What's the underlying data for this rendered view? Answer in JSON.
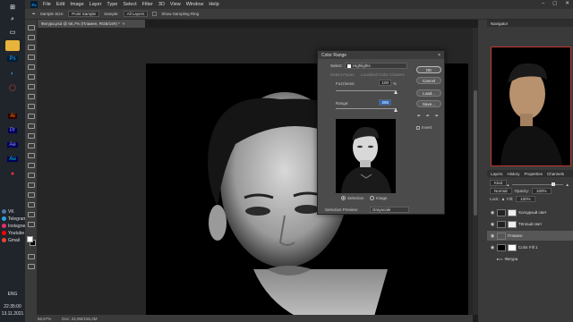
{
  "taskbar": {
    "social": [
      {
        "label": "VK",
        "color": "#4a76a8"
      },
      {
        "label": "Telegram",
        "color": "#2ca5e0"
      },
      {
        "label": "Instagram",
        "color": "#e1306c"
      },
      {
        "label": "Youtube",
        "color": "#ff0000"
      },
      {
        "label": "Gmail",
        "color": "#ea4335"
      }
    ],
    "lang": "ENG",
    "time": "22:35:00",
    "date": "13.11.2021",
    "apps": [
      {
        "label": "Ps",
        "color": "#31a8ff",
        "bg": "#001e36"
      },
      {
        "label": "Ai",
        "color": "#ff9a00",
        "bg": "#330000"
      },
      {
        "label": "Pr",
        "color": "#9999ff",
        "bg": "#00005b"
      },
      {
        "label": "Ae",
        "color": "#9999ff",
        "bg": "#00005b"
      },
      {
        "label": "Au",
        "color": "#00e4bb",
        "bg": "#00005b"
      }
    ]
  },
  "menubar": {
    "items": [
      "File",
      "Edit",
      "Image",
      "Layer",
      "Type",
      "Select",
      "Filter",
      "3D",
      "View",
      "Window",
      "Help"
    ]
  },
  "options": {
    "sample_size_label": "Sample Size:",
    "sample_size_value": "Point Sample",
    "sample_label": "Sample:",
    "sample_value": "All Layers",
    "show_ring": "Show Sampling Ring"
  },
  "document": {
    "tab_title": "Фигура.psd @ 66,7% (Пламен, RGB/16#) *",
    "zoom": "66,67%",
    "doc_size": "Doc: 22,9M/156,2M"
  },
  "dialog": {
    "title": "Color Range",
    "select_label": "Select:",
    "select_value": "Highlights",
    "detect_faces": "Detect Faces",
    "localized": "Localized Color Clusters",
    "fuzziness_label": "Fuzziness:",
    "fuzziness_value": "100",
    "fuzziness_unit": "%",
    "range_label": "Range:",
    "range_value": "255",
    "ok": "OK",
    "cancel": "Cancel",
    "load": "Load...",
    "save": "Save...",
    "invert": "Invert",
    "radio_selection": "Selection",
    "radio_image": "Image",
    "preview_label": "Selection Preview:",
    "preview_value": "Grayscale"
  },
  "panels": {
    "navigator_tab": "Navigator",
    "nav_zoom": "66,67%",
    "layers_tabs": [
      "Layers",
      "History",
      "Properties",
      "Channels"
    ],
    "kind": "Kind",
    "blend": "Normal",
    "opacity_label": "Opacity:",
    "opacity_value": "100%",
    "lock_label": "Lock:",
    "fill_label": "Fill:",
    "fill_value": "100%",
    "layers": [
      {
        "name": "Холодный свет",
        "visible": true
      },
      {
        "name": "Тёплый свет",
        "visible": true
      },
      {
        "name": "Пламен",
        "visible": true
      },
      {
        "name": "Color Fill 1",
        "visible": true
      },
      {
        "name": "Фигура",
        "visible": false
      }
    ]
  }
}
